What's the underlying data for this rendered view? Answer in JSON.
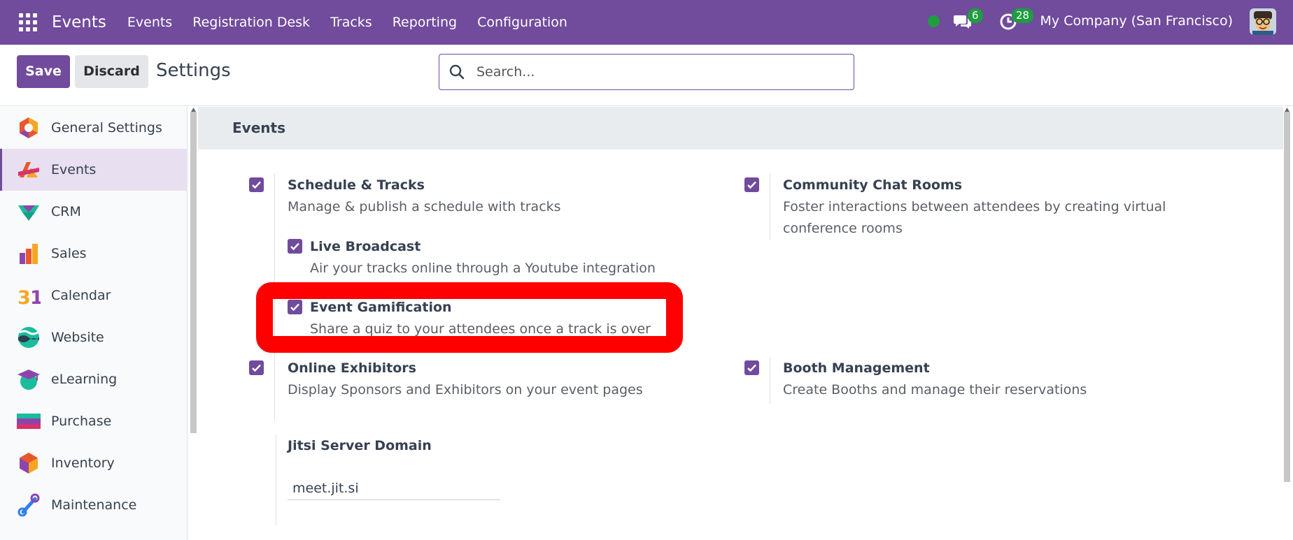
{
  "navbar": {
    "brand": "Events",
    "menu": [
      "Events",
      "Registration Desk",
      "Tracks",
      "Reporting",
      "Configuration"
    ],
    "chat_badge": "6",
    "activity_badge": "28",
    "company": "My Company (San Francisco)",
    "color": "#714b9c"
  },
  "control": {
    "save_label": "Save",
    "discard_label": "Discard",
    "title": "Settings",
    "search_placeholder": "Search..."
  },
  "sidebar": {
    "items": [
      {
        "label": "General Settings",
        "icon": "general-settings-icon"
      },
      {
        "label": "Events",
        "icon": "events-icon",
        "active": true
      },
      {
        "label": "CRM",
        "icon": "crm-icon"
      },
      {
        "label": "Sales",
        "icon": "sales-icon"
      },
      {
        "label": "Calendar",
        "icon": "calendar-icon"
      },
      {
        "label": "Website",
        "icon": "website-icon"
      },
      {
        "label": "eLearning",
        "icon": "elearning-icon"
      },
      {
        "label": "Purchase",
        "icon": "purchase-icon"
      },
      {
        "label": "Inventory",
        "icon": "inventory-icon"
      },
      {
        "label": "Maintenance",
        "icon": "maintenance-icon"
      }
    ]
  },
  "main": {
    "section_title": "Events",
    "settings": {
      "schedule_tracks": {
        "title": "Schedule & Tracks",
        "desc": "Manage & publish a schedule with tracks",
        "checked": true
      },
      "live_broadcast": {
        "title": "Live Broadcast",
        "desc": "Air your tracks online through a Youtube integration",
        "checked": true
      },
      "event_gamification": {
        "title": "Event Gamification",
        "desc": "Share a quiz to your attendees once a track is over",
        "checked": true
      },
      "online_exhibitors": {
        "title": "Online Exhibitors",
        "desc": "Display Sponsors and Exhibitors on your event pages",
        "checked": true
      },
      "community_chat": {
        "title": "Community Chat Rooms",
        "desc": "Foster interactions between attendees by creating virtual conference rooms",
        "checked": true
      },
      "booth_management": {
        "title": "Booth Management",
        "desc": "Create Booths and manage their reservations",
        "checked": true
      },
      "jitsi": {
        "title": "Jitsi Server Domain",
        "value": "meet.jit.si"
      }
    }
  },
  "colors": {
    "accent": "#714b9c",
    "badge": "#1f9d3f",
    "highlight": "#ff0000"
  }
}
